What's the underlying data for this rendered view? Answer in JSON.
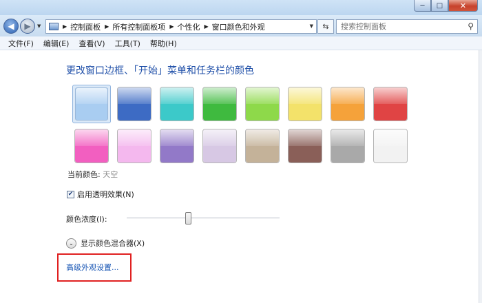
{
  "window": {
    "controls": {
      "minimize": "─",
      "maximize": "□",
      "close": "✕"
    }
  },
  "addressbar": {
    "back_glyph": "◀",
    "forward_glyph": "▶",
    "breadcrumbs": [
      "控制面板",
      "所有控制面板项",
      "个性化",
      "窗口颜色和外观"
    ],
    "refresh_glyph": "⇆",
    "search_placeholder": "搜索控制面板",
    "icons": {
      "location": "control-panel-icon",
      "refresh": "refresh-icon",
      "search": "search-icon"
    }
  },
  "menubar": {
    "items": [
      "文件(F)",
      "编辑(E)",
      "查看(V)",
      "工具(T)",
      "帮助(H)"
    ]
  },
  "main": {
    "heading": "更改窗口边框、「开始」菜单和任务栏的颜色",
    "swatches": [
      {
        "name": "sky",
        "color": "#a9cdf1",
        "selected": true
      },
      {
        "name": "twilight",
        "color": "#3d6bc4"
      },
      {
        "name": "sea-foam",
        "color": "#3cc9c9"
      },
      {
        "name": "leaf",
        "color": "#3fba3f"
      },
      {
        "name": "lime",
        "color": "#8ed94a"
      },
      {
        "name": "banana",
        "color": "#f3e26a"
      },
      {
        "name": "pumpkin",
        "color": "#f5a23a"
      },
      {
        "name": "ruby",
        "color": "#e04444"
      },
      {
        "name": "fuchsia",
        "color": "#f25fc0"
      },
      {
        "name": "blush",
        "color": "#f4b8ee"
      },
      {
        "name": "violet",
        "color": "#9279c8"
      },
      {
        "name": "lavender",
        "color": "#d7c8e4"
      },
      {
        "name": "taupe",
        "color": "#c4b299"
      },
      {
        "name": "chocolate",
        "color": "#8a5f58"
      },
      {
        "name": "slate",
        "color": "#a9a9a9"
      },
      {
        "name": "frost",
        "color": "#f2f2f2"
      }
    ],
    "current_color_label": "当前颜色:",
    "current_color_value": "天空",
    "transparency_label": "启用透明效果(N)",
    "transparency_checked": true,
    "intensity_label": "颜色浓度(I):",
    "intensity_value": 0.4,
    "mixer_label": "显示颜色混合器(X)",
    "advanced_link": "高级外观设置..."
  }
}
